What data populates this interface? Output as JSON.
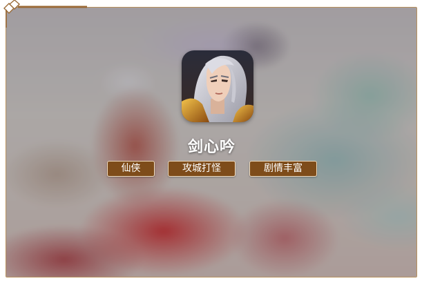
{
  "game": {
    "name": "剑心吟",
    "icon": "game-character-avatar"
  },
  "tags": [
    "仙侠",
    "攻城打怪",
    "剧情丰富"
  ],
  "colors": {
    "frame_border": "#b8905c",
    "tag_background": "#7e4c1a",
    "tag_border": "#f0dcc0",
    "title_text": "#ffffff"
  }
}
